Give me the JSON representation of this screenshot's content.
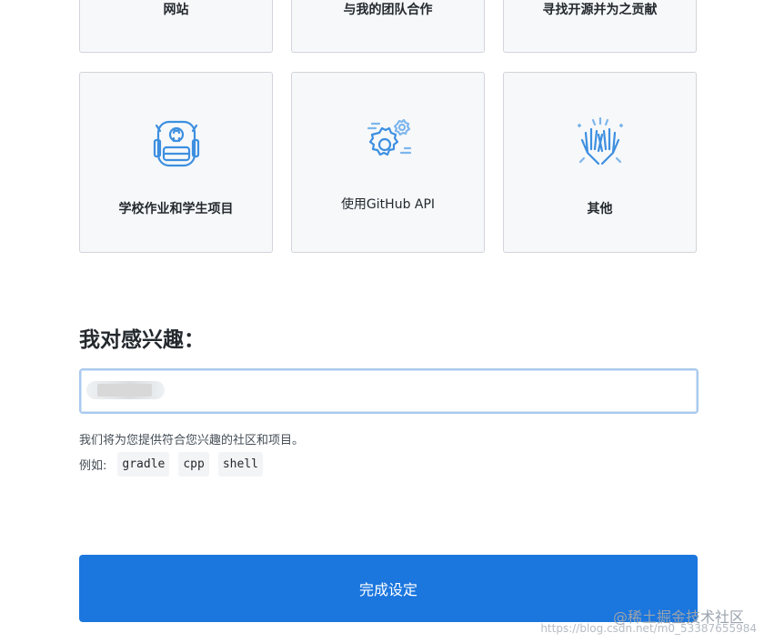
{
  "cards_top": [
    {
      "label": "网站"
    },
    {
      "label": "与我的团队合作"
    },
    {
      "label": "寻找开源并为之贡献"
    }
  ],
  "cards_mid": [
    {
      "label": "学校作业和学生项目",
      "icon": "backpack-icon"
    },
    {
      "label": "使用GitHub API",
      "icon": "gears-icon"
    },
    {
      "label": "其他",
      "icon": "high-five-icon"
    }
  ],
  "interests": {
    "heading": "我对感兴趣：",
    "input_value": "",
    "hint": "我们将为您提供符合您兴趣的社区和项目。",
    "examples_label": "例如:",
    "examples": [
      "gradle",
      "cpp",
      "shell"
    ]
  },
  "submit_label": "完成设定",
  "watermark": "@稀土掘金技术社区",
  "watermark_url": "https://blog.csdn.net/m0_53387655984",
  "colors": {
    "accent": "#1b76de",
    "icon_blue": "#3d8fe0",
    "card_bg": "#f6f8fa",
    "card_border": "#d1d5da"
  }
}
